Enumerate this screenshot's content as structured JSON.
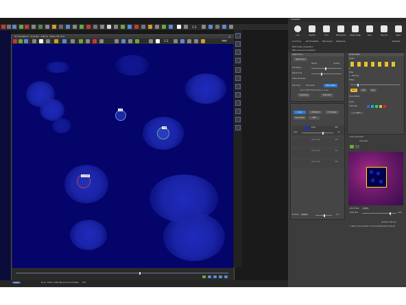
{
  "app": {
    "right_panel_title": "Acquisition"
  },
  "top_toolbar": {
    "zoom_label": "1:1"
  },
  "image_window": {
    "title": "5D: Simulated 2 - 3124.00x - 3.88 nm - Phase, TPL, Z=0",
    "toolbar_zoom": "1:1",
    "zoom_field": "FitPa",
    "roi_labels": [
      "3 R",
      "2 R",
      "1 Al 01"
    ]
  },
  "statusbar": {
    "left_tab": "Depth",
    "center_text": "Mono: 2048 x 2048 (Physical Coordinates)",
    "zoom_text": "53%"
  },
  "acquisition_toolbar": {
    "buttons": [
      {
        "label": "Live",
        "icon": "play-icon"
      },
      {
        "label": "Capture",
        "icon": "camera-icon"
      },
      {
        "label": "Find",
        "icon": "find-icon"
      },
      {
        "label": "NR Acquire",
        "icon": "film-icon"
      },
      {
        "label": "Large Image",
        "icon": "large-image-icon"
      },
      {
        "label": "Save",
        "icon": "save-icon"
      },
      {
        "label": "Save As",
        "icon": "save-as-icon"
      },
      {
        "label": "Open",
        "icon": "open-folder-icon"
      }
    ],
    "row2": [
      "Live Focus",
      "Set Time/Attrs",
      "NIS Acquire",
      "Objectives"
    ],
    "row2_right": "Optimize",
    "row3": [
      "NDS Classic Acquisition",
      "NDS Advanced Acquisition"
    ]
  },
  "scan_area": {
    "header": "Digital Scan",
    "scan_button": "Start Scan",
    "speed_label": "Speed",
    "quality_label": "Quality",
    "averaging_label": "Averaging",
    "dwell_label": "Dwell Time",
    "channel_series_label": "Channel Series",
    "zooming_label": "Zooming",
    "zoom_values": [
      "Panorama",
      "Fit to View"
    ],
    "info_line": "1px: 0.353 Frame Time: 1.1 sec",
    "mode_buttons": [
      "Sampling",
      "Standard"
    ]
  },
  "channels": {
    "header": "Channels",
    "top_buttons": [
      "Inner",
      "Widefield",
      "XY Sweep"
    ],
    "save_label": "Save Pixel",
    "lut_label": "TIRF",
    "rows": [
      {
        "name": "DAPI",
        "value": "405",
        "gain": "Gain",
        "gain_value": "70"
      },
      {
        "name": "Alexa 488",
        "value": "488"
      },
      {
        "name": "Alexa 561",
        "value": "561"
      },
      {
        "name": "Alexa 640",
        "value": "640"
      }
    ],
    "pinhole_label": "Pinhole",
    "pinhole_value": "NONE",
    "pinhole_number": "1.0"
  },
  "right_section": {
    "header": "Optical Path",
    "filter_count": "5",
    "filter_labels": [
      "Ex/Em",
      "Filter",
      "1 - Binning"
    ],
    "pass_label": "Filters",
    "buttons": [
      "Bino",
      "100",
      "Auto"
    ],
    "transmit_label": "Transmitted",
    "lamp_label": "Lamp",
    "ND_label": "Channels",
    "select_value": "1 - LEDs"
  },
  "overview": {
    "header": "Scan Area Drift",
    "overview_label": "Overview",
    "zoom_label": "Zoom Size",
    "zoom_value": "2.00",
    "pixel_size_label": "Pixel Size",
    "pixel_size_value": "0.02",
    "step_label": "Overall: 0.02 µm",
    "bottom_line": "2 step: 0.13 µm  Res: 0.17 µm  Subloading: 0.94 µm"
  }
}
